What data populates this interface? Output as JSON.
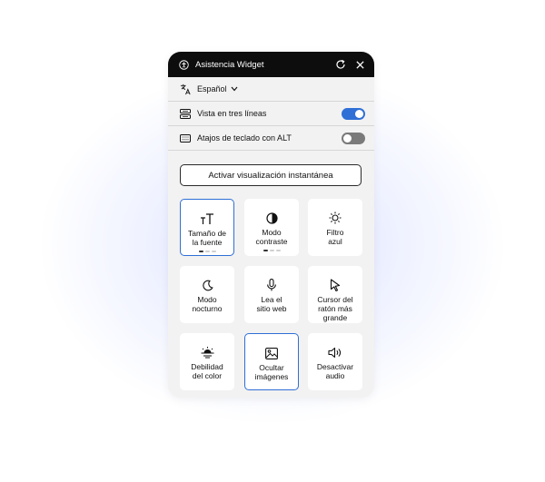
{
  "header": {
    "title": "Asistencia Widget",
    "icons": [
      "accessibility-icon",
      "refresh-icon",
      "close-icon"
    ]
  },
  "language": {
    "label": "Español",
    "icon": "translate-icon"
  },
  "options": [
    {
      "label": "Vista en tres líneas",
      "icon": "three-lines-icon",
      "enabled": true
    },
    {
      "label": "Atajos de teclado con ALT",
      "icon": "keyboard-icon",
      "enabled": false
    }
  ],
  "quick_button": {
    "label": "Activar visualización instantánea"
  },
  "tiles": [
    {
      "label": "Tamaño de\nla fuente",
      "icon": "font-size-icon",
      "selected": true,
      "levels": 3,
      "level": 1
    },
    {
      "label": "Modo\ncontraste",
      "icon": "contrast-icon",
      "selected": false,
      "levels": 3,
      "level": 1
    },
    {
      "label": "Filtro\nazul",
      "icon": "sun-icon",
      "selected": false
    },
    {
      "label": "Modo\nnocturno",
      "icon": "moon-icon",
      "selected": false
    },
    {
      "label": "Lea el\nsitio web",
      "icon": "microphone-icon",
      "selected": false
    },
    {
      "label": "Cursor del\nratón más\ngrande",
      "icon": "cursor-icon",
      "selected": false
    },
    {
      "label": "Debilidad\ndel color",
      "icon": "color-weakness-icon",
      "selected": false
    },
    {
      "label": "Ocultar\nimágenes",
      "icon": "image-icon",
      "selected": true
    },
    {
      "label": "Desactivar\naudio",
      "icon": "speaker-icon",
      "selected": false
    }
  ],
  "colors": {
    "accent": "#2f6fd6",
    "header_bg": "#0d0d0d",
    "panel_bg": "#f2f2f2"
  }
}
